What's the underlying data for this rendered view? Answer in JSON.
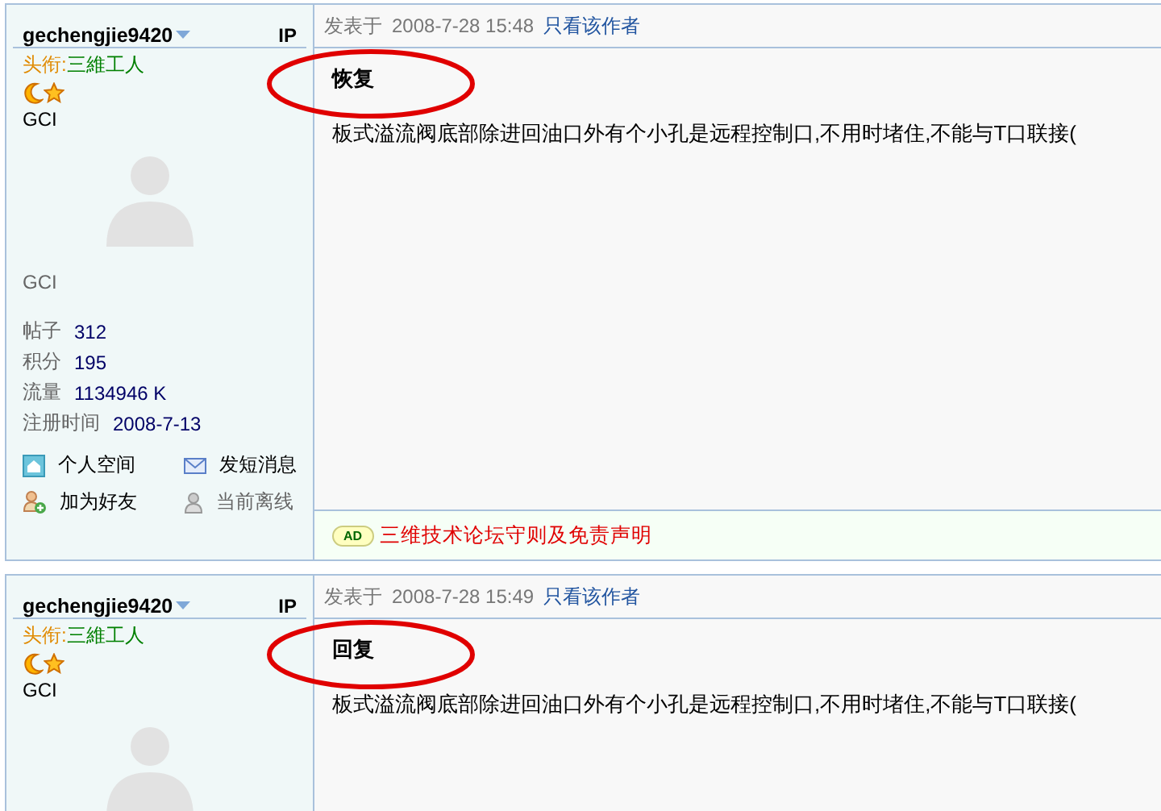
{
  "posts": [
    {
      "author": "gechengjie9420",
      "ip_label": "IP",
      "title_label": "头衔:",
      "user_title": "三維工人",
      "rank": "GCI",
      "group": "GCI",
      "stats": [
        {
          "label": "帖子",
          "value": "312"
        },
        {
          "label": "积分",
          "value": "195"
        },
        {
          "label": "流量",
          "value": "1134946 K"
        },
        {
          "label": "注册时间",
          "value": "2008-7-13"
        }
      ],
      "links": [
        {
          "kind": "home",
          "label": "个人空间"
        },
        {
          "kind": "mail",
          "label": "发短消息"
        },
        {
          "kind": "add",
          "label": "加为好友"
        },
        {
          "kind": "offline",
          "label": "当前离线"
        }
      ],
      "posted_label": "发表于",
      "date": "2008-7-28 15:48",
      "author_only": "只看该作者",
      "subject": "恢复",
      "body": "板式溢流阀底部除进回油口外有个小孔是远程控制口,不用时堵住,不能与T口联接(",
      "circled": true,
      "ad": {
        "badge": "AD",
        "text": "三维技术论坛守则及免责声明"
      }
    },
    {
      "author": "gechengjie9420",
      "ip_label": "IP",
      "title_label": "头衔:",
      "user_title": "三維工人",
      "rank": "GCI",
      "posted_label": "发表于",
      "date": "2008-7-28 15:49",
      "author_only": "只看该作者",
      "subject": "回复",
      "body": "板式溢流阀底部除进回油口外有个小孔是远程控制口,不用时堵住,不能与T口联接(",
      "circled": true
    }
  ]
}
